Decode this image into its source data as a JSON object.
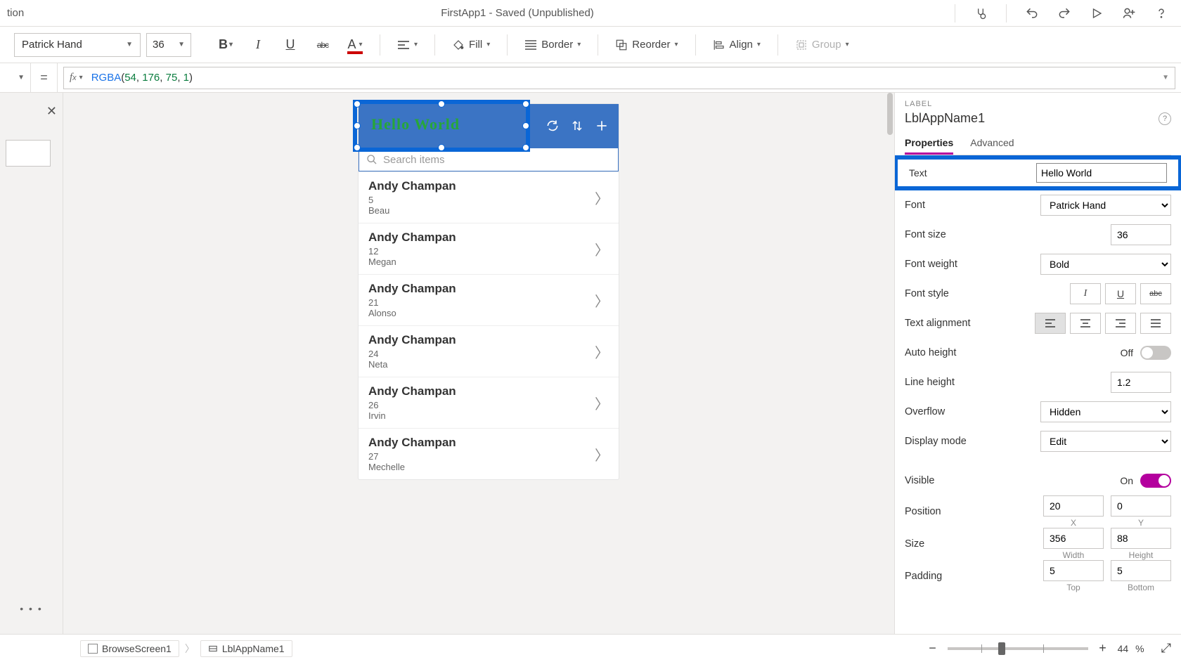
{
  "title_left": "tion",
  "title_center": "FirstApp1 - Saved (Unpublished)",
  "ribbon": {
    "font": "Patrick Hand",
    "size": "36",
    "fill_label": "Fill",
    "border_label": "Border",
    "reorder_label": "Reorder",
    "align_label": "Align",
    "group_label": "Group"
  },
  "formula": {
    "fn": "RGBA",
    "args": [
      "54",
      "176",
      "75",
      "1"
    ]
  },
  "selection_text": "Hello World",
  "phone": {
    "search_placeholder": "Search items",
    "items": [
      {
        "name": "Andy Champan",
        "n": "5",
        "sub": "Beau"
      },
      {
        "name": "Andy Champan",
        "n": "12",
        "sub": "Megan"
      },
      {
        "name": "Andy Champan",
        "n": "21",
        "sub": "Alonso"
      },
      {
        "name": "Andy Champan",
        "n": "24",
        "sub": "Neta"
      },
      {
        "name": "Andy Champan",
        "n": "26",
        "sub": "Irvin"
      },
      {
        "name": "Andy Champan",
        "n": "27",
        "sub": "Mechelle"
      }
    ]
  },
  "props": {
    "category": "LABEL",
    "name": "LblAppName1",
    "tab_props": "Properties",
    "tab_adv": "Advanced",
    "text_label": "Text",
    "text_value": "Hello World",
    "font_label": "Font",
    "font_value": "Patrick Hand",
    "fontsize_label": "Font size",
    "fontsize_value": "36",
    "fontweight_label": "Font weight",
    "fontweight_value": "Bold",
    "fontstyle_label": "Font style",
    "textalign_label": "Text alignment",
    "autoheight_label": "Auto height",
    "autoheight_state": "Off",
    "lineheight_label": "Line height",
    "lineheight_value": "1.2",
    "overflow_label": "Overflow",
    "overflow_value": "Hidden",
    "displaymode_label": "Display mode",
    "displaymode_value": "Edit",
    "visible_label": "Visible",
    "visible_state": "On",
    "position_label": "Position",
    "pos_x": "20",
    "pos_y": "0",
    "pos_x_sub": "X",
    "pos_y_sub": "Y",
    "size_label": "Size",
    "size_w": "356",
    "size_h": "88",
    "size_w_sub": "Width",
    "size_h_sub": "Height",
    "padding_label": "Padding",
    "pad_t": "5",
    "pad_b": "5",
    "pad_t_sub": "Top",
    "pad_b_sub": "Bottom"
  },
  "breadcrumb": {
    "screen": "BrowseScreen1",
    "control": "LblAppName1"
  },
  "zoom_pct": "44",
  "zoom_unit": "%"
}
